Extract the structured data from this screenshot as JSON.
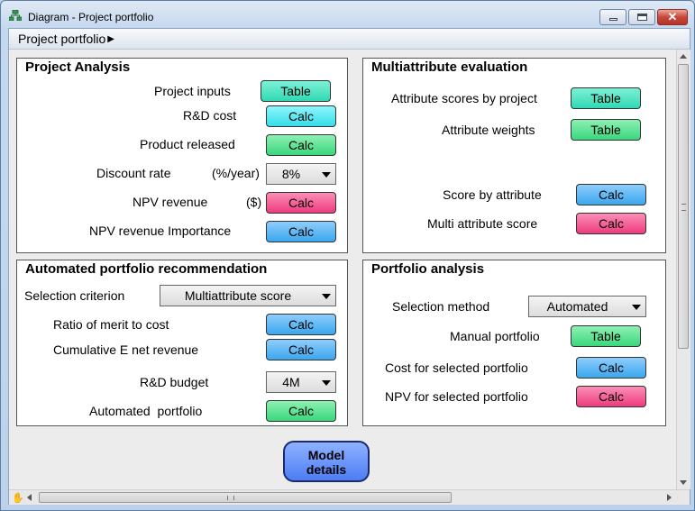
{
  "window": {
    "title": "Diagram - Project portfolio",
    "close_glyph": "✕"
  },
  "breadcrumb": {
    "label": "Project portfolio",
    "arrow": "▶"
  },
  "project_analysis": {
    "title": "Project Analysis",
    "project_inputs_label": "Project inputs",
    "project_inputs_btn": "Table",
    "rd_cost_label": "R&D cost",
    "rd_cost_btn": "Calc",
    "product_released_label": "Product released",
    "product_released_btn": "Calc",
    "discount_rate_label": "Discount rate",
    "discount_rate_unit": "(%/year)",
    "discount_rate_value": "8%",
    "npv_revenue_label": "NPV revenue",
    "npv_revenue_unit": "($)",
    "npv_revenue_btn": "Calc",
    "npv_importance_label": "NPV revenue Importance",
    "npv_importance_btn": "Calc"
  },
  "multiattribute": {
    "title": "Multiattribute evaluation",
    "attr_scores_label": "Attribute scores by project",
    "attr_scores_btn": "Table",
    "attr_weights_label": "Attribute weights",
    "attr_weights_btn": "Table",
    "score_by_attr_label": "Score by attribute",
    "score_by_attr_btn": "Calc",
    "multi_score_label": "Multi attribute score",
    "multi_score_btn": "Calc"
  },
  "automated": {
    "title": "Automated portfolio recommendation",
    "selection_criterion_label": "Selection criterion",
    "selection_criterion_value": "Multiattribute score",
    "ratio_label": "Ratio of merit to cost",
    "ratio_btn": "Calc",
    "cumulative_label": "Cumulative E net revenue",
    "cumulative_btn": "Calc",
    "budget_label": "R&D budget",
    "budget_value": "4M",
    "auto_portfolio_label": "Automated  portfolio",
    "auto_portfolio_btn": "Calc"
  },
  "portfolio_analysis": {
    "title": "Portfolio analysis",
    "selection_method_label": "Selection method",
    "selection_method_value": "Automated",
    "manual_label": "Manual portfolio",
    "manual_btn": "Table",
    "cost_label": "Cost for selected portfolio",
    "cost_btn": "Calc",
    "npv_label": "NPV for selected portfolio",
    "npv_btn": "Calc"
  },
  "model_details": {
    "line1": "Model",
    "line2": "details"
  },
  "scroll": {
    "hand_icon": "✋"
  },
  "colors": {
    "teal": "#2fd9b3",
    "cyan": "#35dde9",
    "green": "#39d77c",
    "blue": "#3aa7ee",
    "pink": "#ee3b7e",
    "model": "#4d7df4"
  }
}
